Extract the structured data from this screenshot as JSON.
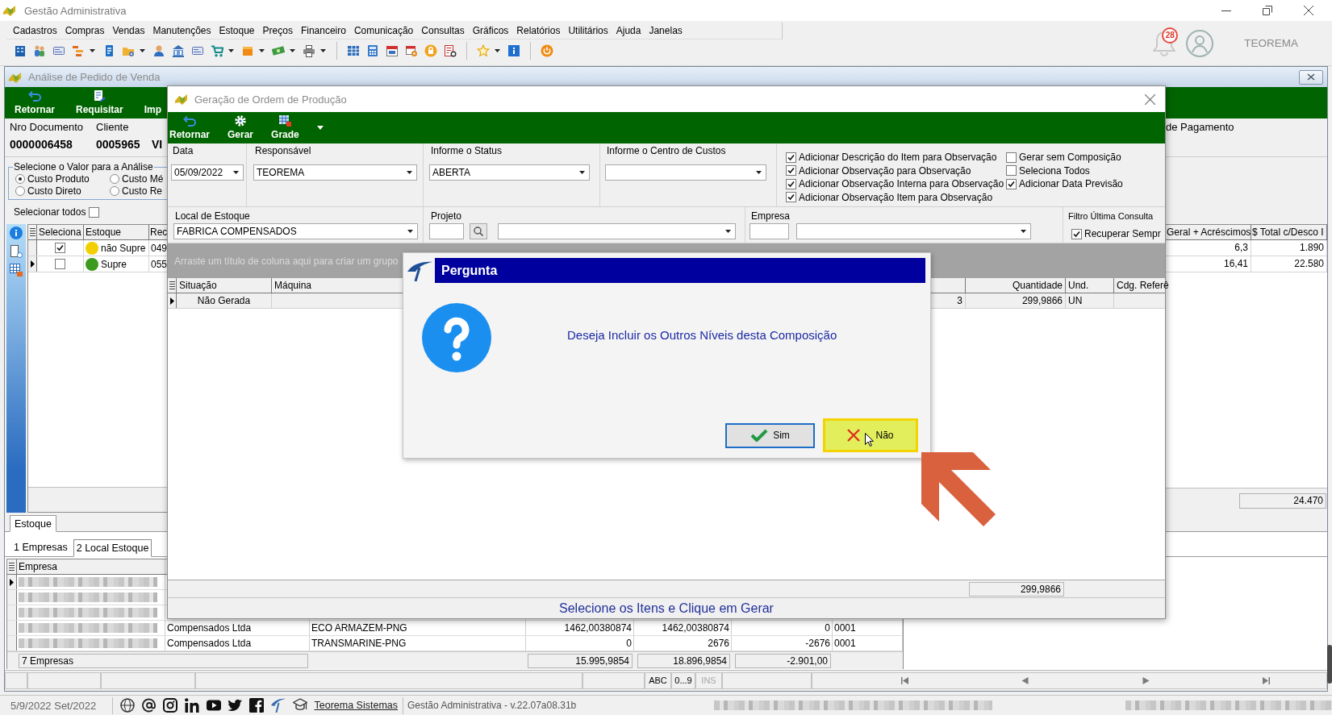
{
  "app": {
    "title": "Gestão Administrativa",
    "menu": [
      "Cadastros",
      "Compras",
      "Vendas",
      "Manutenções",
      "Estoque",
      "Preços",
      "Financeiro",
      "Comunicação",
      "Consultas",
      "Gráficos",
      "Relatórios",
      "Utilitários",
      "Ajuda",
      "Janelas"
    ],
    "notification_count": "28",
    "user": "TEOREMA"
  },
  "analysis_window": {
    "title": "Análise de Pedido de Venda",
    "toolbar": [
      "Retornar",
      "Requisitar",
      "Imp"
    ],
    "document_fields": [
      {
        "label": "Nro Documento",
        "value": "0000006458"
      },
      {
        "label": "Cliente",
        "value": "0005965"
      },
      {
        "value": "VI"
      }
    ],
    "payment_label": "de Pagamento",
    "value_group": {
      "title": "Selecione o Valor para a Análise",
      "options": [
        {
          "label": "Custo Produto",
          "selected": true
        },
        {
          "label": "Custo Mé",
          "selected": false
        },
        {
          "label": "Custo Direto",
          "selected": false
        },
        {
          "label": "Custo Re",
          "selected": false
        }
      ]
    },
    "select_all": {
      "label": "Selecionar todos",
      "checked": false
    },
    "items_table": {
      "columns": [
        "Seleciona",
        "Estoque",
        "Rec"
      ],
      "right_columns": [
        "Geral + Acréscimos",
        "$ Total c/Desco I"
      ],
      "rows": [
        {
          "current": false,
          "checked": true,
          "color": "#f2cf00",
          "estoque": "não Supre",
          "rec": "049",
          "right_cells": [
            "6,3",
            "1.890"
          ]
        },
        {
          "current": true,
          "checked": false,
          "color": "#3c9a1e",
          "estoque": "Supre",
          "rec": "055",
          "right_cells": [
            "16,41",
            "22.580"
          ]
        }
      ],
      "total": "24.470"
    },
    "stock_panel": {
      "tabs": [
        {
          "label": "Estoque",
          "selected": true
        }
      ],
      "subtabs": [
        {
          "label": "1 Empresas",
          "selected": false
        },
        {
          "label": "2 Local Estoque",
          "selected": true
        }
      ],
      "columns": [
        "Empresa"
      ],
      "rows": [
        {
          "current": true
        },
        {
          "current": false
        },
        {
          "current": false
        },
        {
          "current": false,
          "cells": [
            "Compensados Ltda",
            "ECO ARMAZEM-PNG",
            "1462,00380874",
            "1462,00380874",
            "0",
            "0001"
          ]
        },
        {
          "current": false,
          "cells": [
            "Compensados Ltda",
            "TRANSMARINE-PNG",
            "0",
            "2676",
            "-2676",
            "0001"
          ]
        }
      ],
      "footer": {
        "count": "7 Empresas",
        "totals": [
          "15.995,9854",
          "18.896,9854",
          "-2.901,00"
        ]
      }
    },
    "status_bar": [
      {
        "label": "ABC",
        "disabled": false
      },
      {
        "label": "0...9",
        "disabled": false
      },
      {
        "label": "INS",
        "disabled": true
      }
    ]
  },
  "production_window": {
    "title": "Geração de Ordem de Produção",
    "toolbar": [
      "Retornar",
      "Gerar",
      "Grade"
    ],
    "fields": [
      {
        "label": "Data",
        "value": "05/09/2022"
      },
      {
        "label": "Responsável",
        "value": "TEOREMA"
      },
      {
        "label": "Informe o Status",
        "value": "ABERTA"
      },
      {
        "label": "Informe o Centro de Custos"
      }
    ],
    "option_columns": [
      [
        {
          "label": "Adicionar Descrição do Item para Observação",
          "checked": true
        },
        {
          "label": "Adicionar Observação para Observação",
          "checked": true
        },
        {
          "label": "Adicionar Observação Interna para Observação",
          "checked": true
        },
        {
          "label": "Adicionar Observação Item para Observação",
          "checked": true
        }
      ],
      [
        {
          "label": "Gerar sem Composição",
          "checked": false
        },
        {
          "label": "Seleciona Todos",
          "checked": false
        },
        {
          "label": "Adicionar Data Previsão",
          "checked": true
        }
      ]
    ],
    "stock_location": {
      "label": "Local de Estoque",
      "value": "FABRICA COMPENSADOS"
    },
    "project": {
      "label": "Projeto"
    },
    "company": {
      "label": "Empresa"
    },
    "last_query": {
      "title": "Filtro Última Consulta",
      "option": {
        "label": "Recuperar Sempr",
        "checked": true
      }
    },
    "group_hint": "Arraste um título de coluna aqui para criar um grupo",
    "table": {
      "columns": [
        "Situação",
        "Máquina"
      ],
      "right_columns": [
        "Quantidade",
        "Und.",
        "Cdg. Referê"
      ],
      "rows": [
        {
          "current": true,
          "situacao": "Não Gerada",
          "column_3": "3",
          "quantidade": "299,9866",
          "und": "UN"
        }
      ],
      "total": "299,9866"
    },
    "status": "Selecione os Itens e Clique em Gerar"
  },
  "dialog": {
    "title": "Pergunta",
    "message": "Deseja Incluir os Outros Níveis desta Composição",
    "buttons": [
      {
        "label": "Sim",
        "kind": "yes",
        "default": true,
        "hovered": false
      },
      {
        "label": "Não",
        "kind": "no",
        "default": false,
        "hovered": true
      }
    ]
  },
  "app_status": {
    "date": "5/9/2022 Set/2022",
    "link": "Teorema Sistemas",
    "version": "Gestão Administrativa - v.22.07a08.31b"
  }
}
